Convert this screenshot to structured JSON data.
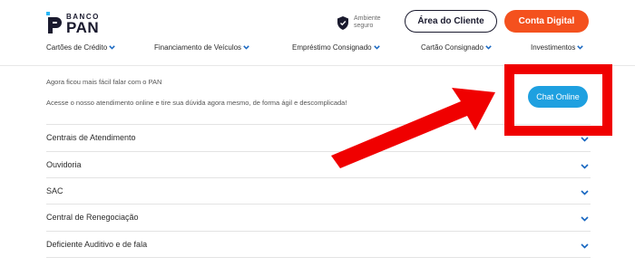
{
  "header": {
    "logo": {
      "small": "BANCO",
      "big": "PAN"
    },
    "secure": {
      "text": "Ambiente seguro"
    },
    "area_cliente_label": "Área do Cliente",
    "conta_digital_label": "Conta Digital"
  },
  "nav": {
    "items": [
      {
        "label": "Cartões de Crédito"
      },
      {
        "label": "Financiamento de Veículos"
      },
      {
        "label": "Empréstimo Consignado"
      },
      {
        "label": "Cartão Consignado"
      },
      {
        "label": "Investimentos"
      }
    ]
  },
  "main": {
    "intro_line1": "Agora ficou mais fácil falar com o PAN",
    "intro_line2": "Acesse o nosso atendimento online e tire sua dúvida agora mesmo, de forma ágil e descomplicada!",
    "chat_button_label": "Chat Online",
    "accordion": [
      {
        "label": "Centrais de Atendimento"
      },
      {
        "label": "Ouvidoria"
      },
      {
        "label": "SAC"
      },
      {
        "label": "Central de Renegociação"
      },
      {
        "label": "Deficiente Auditivo e de fala"
      }
    ]
  },
  "colors": {
    "brand_dark": "#1a1a2e",
    "accent_orange": "#f4511e",
    "chat_blue": "#1ea0e0",
    "chevron_blue": "#1565c0",
    "annotation_red": "#f00000"
  },
  "icons": {
    "logo": "pan-logo-icon",
    "secure": "shield-icon",
    "chevron": "chevron-down-icon"
  }
}
